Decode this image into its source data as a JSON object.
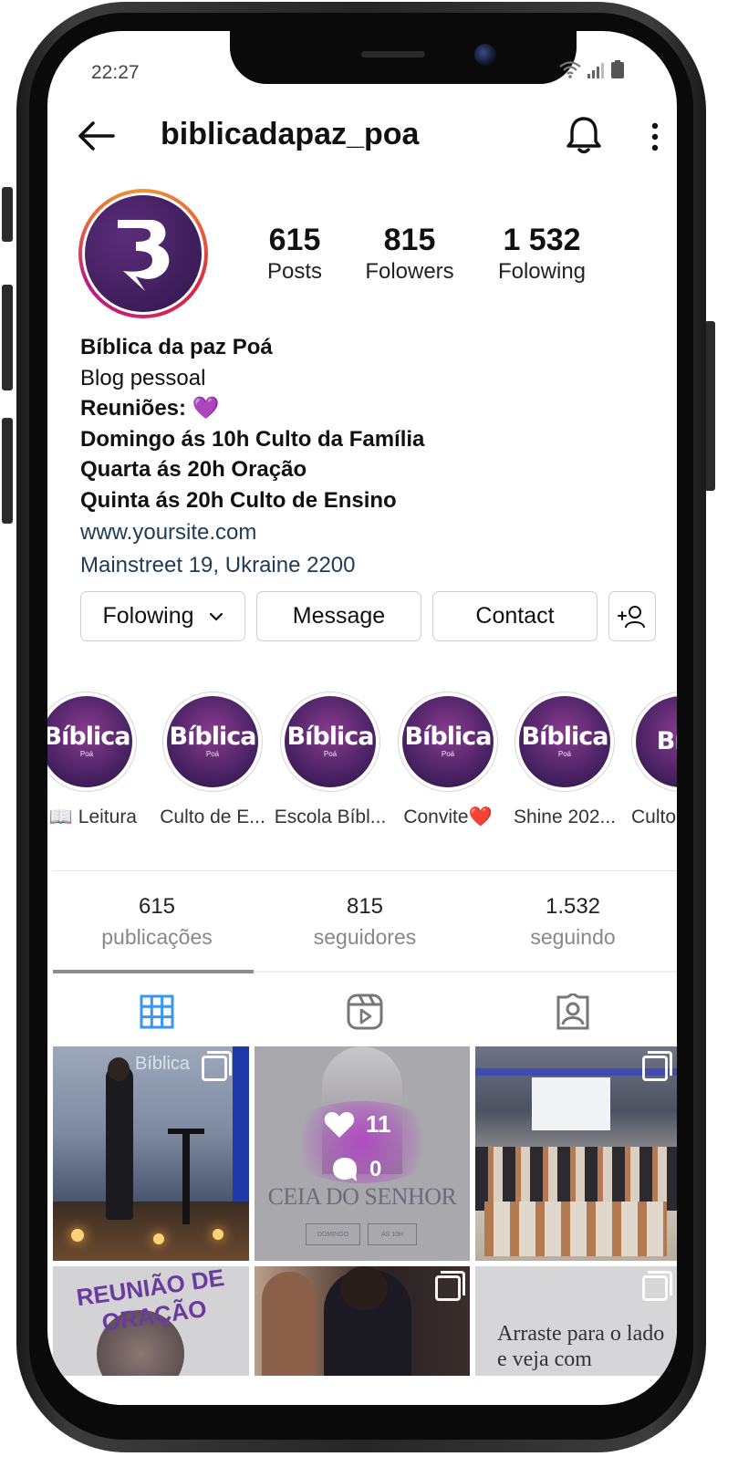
{
  "status_bar": {
    "time": "22:27"
  },
  "header": {
    "username": "biblicadapaz_poa"
  },
  "stats": [
    {
      "value": "615",
      "label": "Posts"
    },
    {
      "value": "815",
      "label": "Folowers"
    },
    {
      "value": "1 532",
      "label": "Folowing"
    }
  ],
  "bio": {
    "name": "Bíblica da paz Poá",
    "category": "Blog pessoal",
    "line1": "Reuniões: 💜",
    "line2": "Domingo ás 10h Culto da Família",
    "line3": "Quarta ás 20h Oração",
    "line4": "Quinta ás 20h Culto de Ensino",
    "website": "www.yoursite.com",
    "address": "Mainstreet 19, Ukraine 2200"
  },
  "actions": {
    "following": "Folowing",
    "message": "Message",
    "contact": "Contact"
  },
  "highlights": [
    {
      "label": "Leitura 📖",
      "title": "Bíblica",
      "sub": "Poá"
    },
    {
      "label": "Culto de E...",
      "title": "Bíblica",
      "sub": "Poá"
    },
    {
      "label": "Escola Bíbl...",
      "title": "Bíblica",
      "sub": "Poá"
    },
    {
      "label": "Convite❤️",
      "title": "Bíblica",
      "sub": "Poá"
    },
    {
      "label": "Shine 202...",
      "title": "Bíblica",
      "sub": "Poá"
    },
    {
      "label": "Culto",
      "title": "Bíbl",
      "sub": ""
    }
  ],
  "counts": [
    {
      "value": "615",
      "label": "publicações"
    },
    {
      "value": "815",
      "label": "seguidores"
    },
    {
      "value": "1.532",
      "label": "seguindo"
    }
  ],
  "posts": {
    "p1_text": "Bíblica",
    "p2_likes": "11",
    "p2_comments": "0",
    "p2_title": "CEIA DO SENHOR",
    "p2_tag1": "DOMINGO",
    "p2_tag2": "ÀS 10H",
    "p4_text": "REUNIÃO DE ORAÇÃO",
    "p6_text": "Arraste para o lado e veja com"
  },
  "colors": {
    "accent_blue": "#3897f0",
    "brand_purple": "#4b2365"
  }
}
